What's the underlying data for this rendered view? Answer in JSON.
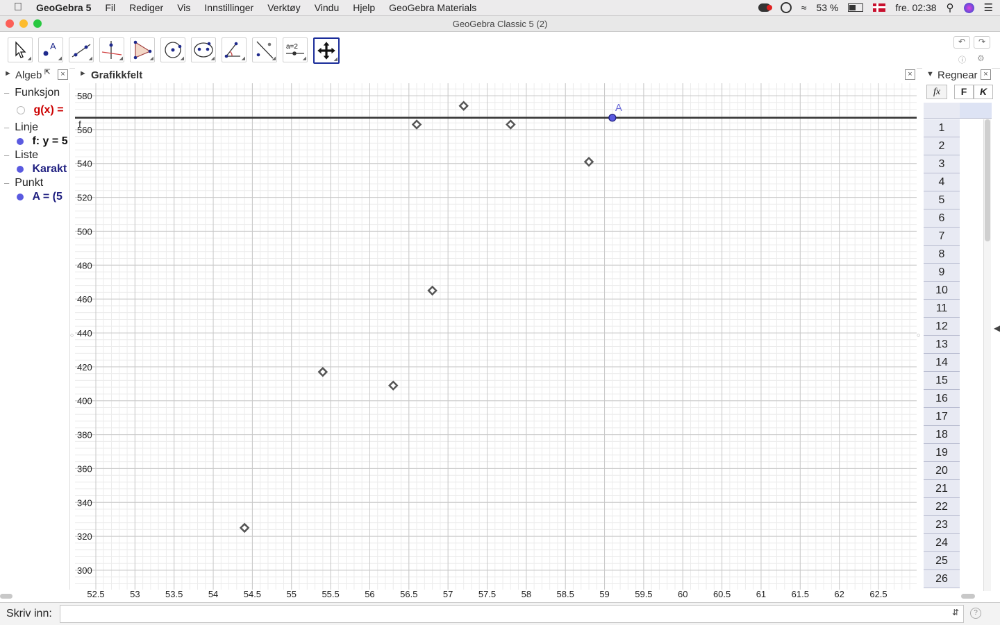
{
  "menubar": {
    "app_name": "GeoGebra 5",
    "items": [
      "Fil",
      "Rediger",
      "Vis",
      "Innstillinger",
      "Verktøy",
      "Vindu",
      "Hjelp",
      "GeoGebra Materials"
    ],
    "battery": "53 %",
    "clock": "fre. 02:38"
  },
  "window": {
    "title": "GeoGebra Classic 5 (2)"
  },
  "toolbar": {
    "tools": [
      {
        "name": "move-tool"
      },
      {
        "name": "point-tool"
      },
      {
        "name": "line-tool"
      },
      {
        "name": "perpendicular-line-tool"
      },
      {
        "name": "polygon-tool"
      },
      {
        "name": "circle-tool"
      },
      {
        "name": "ellipse-tool"
      },
      {
        "name": "angle-tool"
      },
      {
        "name": "reflect-tool"
      },
      {
        "name": "slider-tool"
      },
      {
        "name": "move-graphics-view-tool"
      }
    ],
    "selected_index": 10,
    "slider_label": "a=2"
  },
  "algebra": {
    "header": "Algeb",
    "groups": [
      {
        "label": "Funksjon",
        "item": "g(x) =",
        "item_color": "#cc0000",
        "dot": "hollow"
      },
      {
        "label": "Linje",
        "item": "f: y = 5",
        "item_color": "#111111",
        "dot": "filled"
      },
      {
        "label": "Liste",
        "item": "Karakt",
        "item_color": "#1f1f80",
        "dot": "filled"
      },
      {
        "label": "Punkt",
        "item": "A = (5",
        "item_color": "#1f1f80",
        "dot": "filled"
      }
    ]
  },
  "graphics": {
    "header": "Grafikkfelt",
    "line_label": "f",
    "point_label": "A",
    "x_ticks": [
      "52.5",
      "53",
      "53.5",
      "54",
      "54.5",
      "55",
      "55.5",
      "56",
      "56.5",
      "57",
      "57.5",
      "58",
      "58.5",
      "59",
      "59.5",
      "60",
      "60.5",
      "61",
      "61.5",
      "62",
      "62.5"
    ],
    "y_ticks": [
      "300",
      "320",
      "340",
      "360",
      "380",
      "400",
      "420",
      "440",
      "460",
      "480",
      "500",
      "520",
      "540",
      "560",
      "580"
    ]
  },
  "chart_data": {
    "type": "scatter",
    "xlim": [
      52.5,
      62.5
    ],
    "ylim": [
      300,
      580
    ],
    "points": [
      {
        "x": 54.4,
        "y": 325
      },
      {
        "x": 55.4,
        "y": 417
      },
      {
        "x": 56.3,
        "y": 409
      },
      {
        "x": 56.6,
        "y": 563
      },
      {
        "x": 56.8,
        "y": 465
      },
      {
        "x": 57.2,
        "y": 574
      },
      {
        "x": 57.8,
        "y": 563
      },
      {
        "x": 58.8,
        "y": 541
      }
    ],
    "line_y": 567,
    "point_A": {
      "x": 59.1,
      "y": 567
    },
    "colors": {
      "marker": "#555555",
      "line": "#333333",
      "point": "#5a5ae0",
      "grid_major": "#c8c8c8",
      "grid_minor": "#ececec"
    }
  },
  "spreadsheet": {
    "header": "Regnear",
    "fx_label": "fx",
    "bold_label": "F",
    "italic_label": "K",
    "rows": [
      "1",
      "2",
      "3",
      "4",
      "5",
      "6",
      "7",
      "8",
      "9",
      "10",
      "11",
      "12",
      "13",
      "14",
      "15",
      "16",
      "17",
      "18",
      "19",
      "20",
      "21",
      "22",
      "23",
      "24",
      "25",
      "26"
    ]
  },
  "input": {
    "label": "Skriv inn:"
  }
}
